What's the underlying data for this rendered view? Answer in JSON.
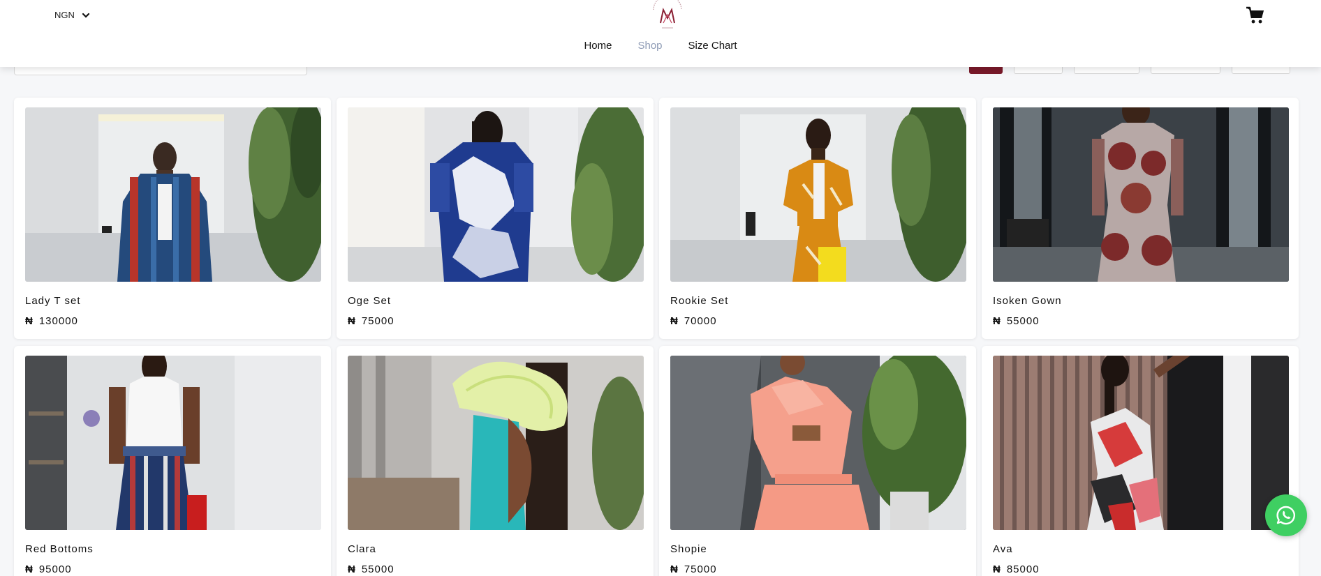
{
  "header": {
    "currency": "NGN",
    "nav": [
      "Home",
      "Shop",
      "Size Chart"
    ],
    "active_nav": "Shop"
  },
  "colors": {
    "accent": "#7a1a2a",
    "nav_active": "#8e9bb5",
    "whatsapp": "#3fcf62"
  },
  "products": [
    {
      "name": "Lady T set",
      "currency": "₦",
      "price": "130000"
    },
    {
      "name": "Oge Set",
      "currency": "₦",
      "price": "75000"
    },
    {
      "name": "Rookie Set",
      "currency": "₦",
      "price": "70000"
    },
    {
      "name": "Isoken Gown",
      "currency": "₦",
      "price": "55000"
    },
    {
      "name": "Red Bottoms",
      "currency": "₦",
      "price": "95000"
    },
    {
      "name": "Clara",
      "currency": "₦",
      "price": "55000"
    },
    {
      "name": "Shopie",
      "currency": "₦",
      "price": "75000"
    },
    {
      "name": "Ava",
      "currency": "₦",
      "price": "85000"
    }
  ],
  "icons": {
    "cart": "shopping-cart-icon",
    "currency_toggle": "chevron-down-icon",
    "chat": "whatsapp-icon"
  }
}
